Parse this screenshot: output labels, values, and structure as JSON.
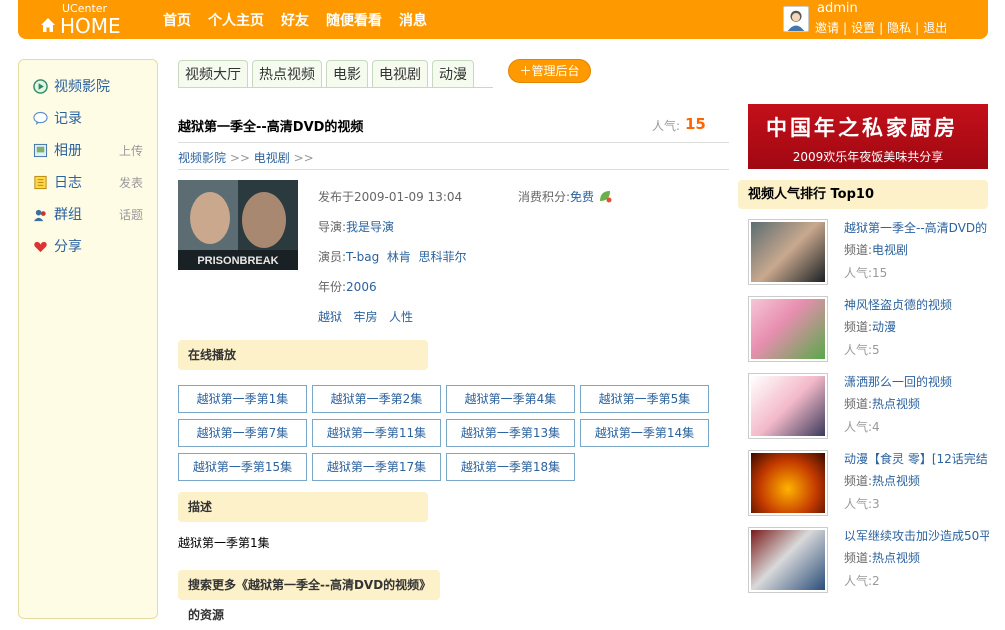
{
  "header": {
    "logo_top": "UCenter",
    "logo_main": "HOME",
    "nav": [
      "首页",
      "个人主页",
      "好友",
      "随便看看",
      "消息"
    ],
    "username": "admin",
    "user_links": [
      "邀请",
      "设置",
      "隐私",
      "退出"
    ]
  },
  "sidebar": {
    "items": [
      {
        "label": "视频影院",
        "extra": "",
        "icon": "play-icon"
      },
      {
        "label": "记录",
        "extra": "",
        "icon": "speech-bubble-icon"
      },
      {
        "label": "相册",
        "extra": "上传",
        "icon": "photo-album-icon"
      },
      {
        "label": "日志",
        "extra": "发表",
        "icon": "notebook-icon"
      },
      {
        "label": "群组",
        "extra": "话题",
        "icon": "group-icon"
      },
      {
        "label": "分享",
        "extra": "",
        "icon": "heart-share-icon"
      }
    ]
  },
  "tabs": [
    "视频大厅",
    "热点视频",
    "电影",
    "电视剧",
    "动漫"
  ],
  "admin_button": "管理后台",
  "video": {
    "title": "越狱第一季全--高清DVD的视频",
    "popularity_label": "人气:",
    "popularity": "15",
    "breadcrumb": [
      "视频影院",
      "电视剧"
    ],
    "published": "发布于2009-01-09 13:04",
    "cost_label": "消费积分:",
    "cost_value": "免费",
    "director_label": "导演:",
    "director": "我是导演",
    "actors_label": "演员:",
    "actors": [
      "T-bag",
      "林肯",
      "思科菲尔"
    ],
    "year_label": "年份:",
    "year": "2006",
    "tags": [
      "越狱",
      "牢房",
      "人性"
    ],
    "poster_text": "PRISONBREAK"
  },
  "sections": {
    "online": "在线播放",
    "description": "描述",
    "search_more": "搜索更多《越狱第一季全--高清DVD的视频》的资源"
  },
  "episodes": [
    "越狱第一季第1集",
    "越狱第一季第2集",
    "越狱第一季第4集",
    "越狱第一季第5集",
    "越狱第一季第7集",
    "越狱第一季第11集",
    "越狱第一季第13集",
    "越狱第一季第14集",
    "越狱第一季第15集",
    "越狱第一季第17集",
    "越狱第一季第18集"
  ],
  "description_text": "越狱第一季第1集",
  "banner": {
    "line1": "中国年之私家厨房",
    "line2": "2009欢乐年夜饭美味共分享"
  },
  "ranking": {
    "title": "视频人气排行 Top10",
    "channel_label": "频道:",
    "pop_label": "人气:",
    "items": [
      {
        "title": "越狱第一季全--高清DVD的",
        "channel": "电视剧",
        "pop": "15"
      },
      {
        "title": "神风怪盗贞德的视频",
        "channel": "动漫",
        "pop": "5"
      },
      {
        "title": "潇洒那么一回的视频",
        "channel": "热点视频",
        "pop": "4"
      },
      {
        "title": "动漫【食灵 零】[12话完结",
        "channel": "热点视频",
        "pop": "3"
      },
      {
        "title": "以军继续攻击加沙造成50平",
        "channel": "热点视频",
        "pop": "2"
      }
    ]
  },
  "colors": {
    "header": "#ff9900",
    "link": "#2c629e",
    "section_bg": "#fcf1c8",
    "sidebar_bg": "#fffce6",
    "popularity": "#ff6600"
  }
}
